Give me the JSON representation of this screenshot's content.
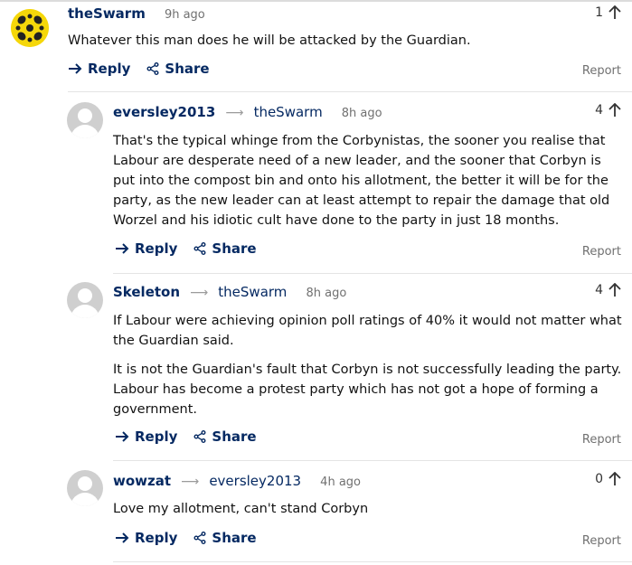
{
  "comments": [
    {
      "username": "theSwarm",
      "reply_to": "",
      "time": "9h ago",
      "votes": "1",
      "paragraphs": [
        "Whatever this man does he will be attacked by the Guardian."
      ],
      "reply_label": "Reply",
      "share_label": "Share",
      "report_label": "Report"
    },
    {
      "username": "eversley2013",
      "reply_to": "theSwarm",
      "time": "8h ago",
      "votes": "4",
      "paragraphs": [
        "That's the typical whinge from the Corbynistas, the sooner you realise that Labour are desperate need of a new leader, and the sooner that Corbyn is put into the compost bin and onto his allotment, the better it will be for the party, as the new leader can at least attempt to repair the damage that old Worzel and his idiotic cult have done to the party in just 18 months."
      ],
      "reply_label": "Reply",
      "share_label": "Share",
      "report_label": "Report"
    },
    {
      "username": "Skeleton",
      "reply_to": "theSwarm",
      "time": "8h ago",
      "votes": "4",
      "paragraphs": [
        "If Labour were achieving opinion poll ratings of 40% it would not matter what the Guardian said.",
        "It is not the Guardian's fault that Corbyn is not successfully leading the party. Labour has become a protest party which has not got a hope of forming a government."
      ],
      "reply_label": "Reply",
      "share_label": "Share",
      "report_label": "Report"
    },
    {
      "username": "wowzat",
      "reply_to": "eversley2013",
      "time": "4h ago",
      "votes": "0",
      "paragraphs": [
        "Love my allotment, can't stand Corbyn"
      ],
      "reply_label": "Reply",
      "share_label": "Share",
      "report_label": "Report"
    }
  ],
  "icons": {
    "reply": "reply-arrow-icon",
    "share": "share-icon",
    "upvote": "up-arrow-icon",
    "reply_to": "right-arrow-icon",
    "avatar_default": "default-user-icon"
  },
  "colors": {
    "username": "#052962",
    "meta": "#707070",
    "text": "#121212",
    "swarm_avatar": "#f5d70a"
  }
}
